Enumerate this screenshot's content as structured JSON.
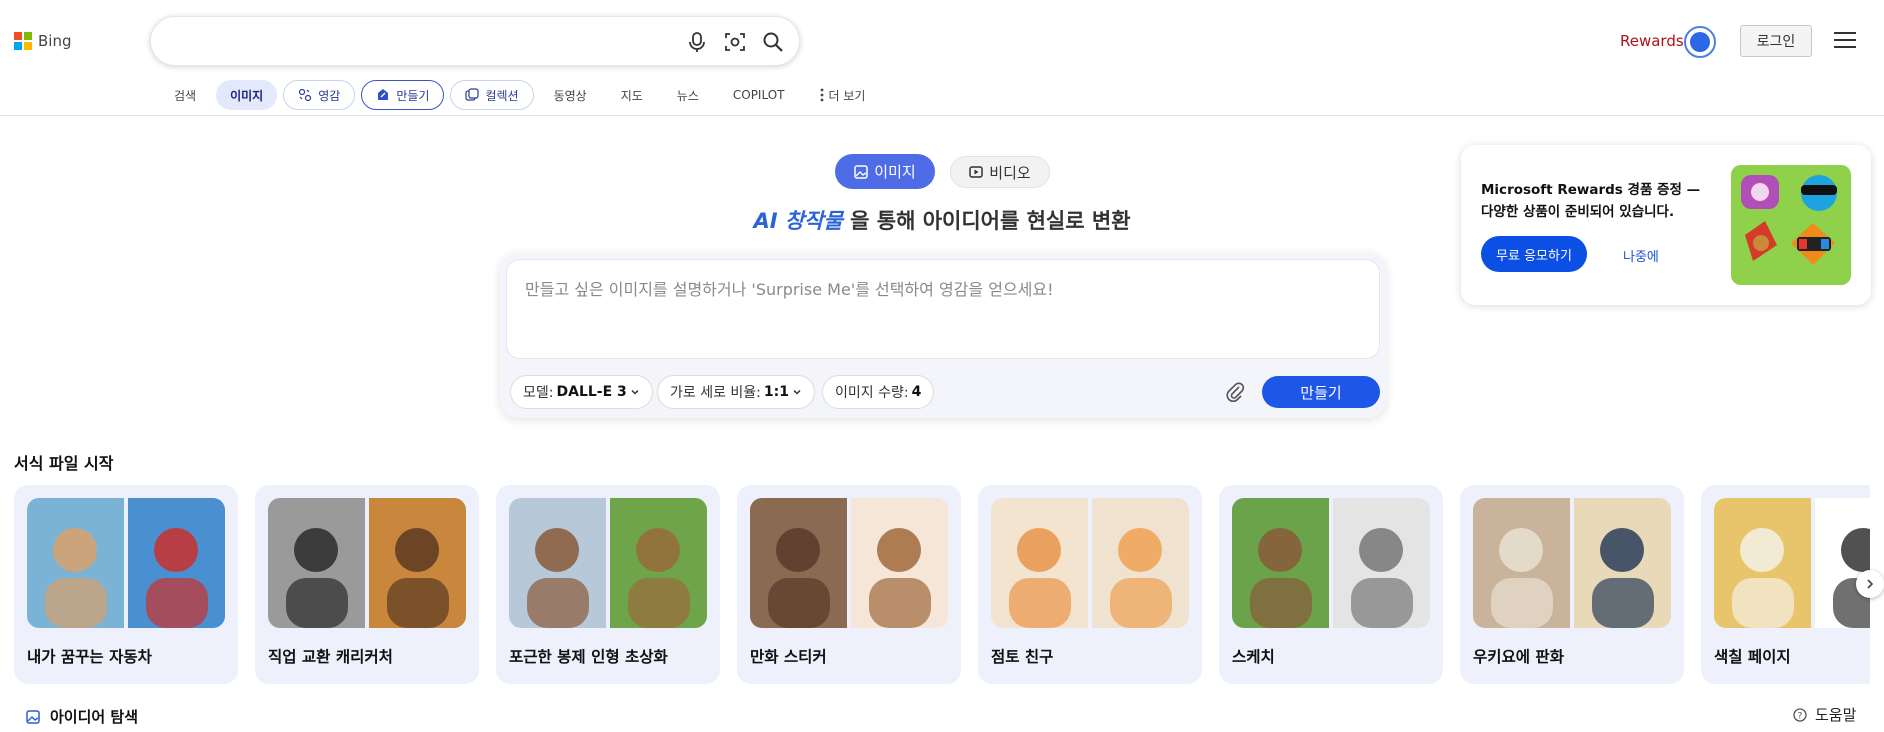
{
  "brand": {
    "name": "Bing",
    "logo_colors": [
      "#f25022",
      "#7fba00",
      "#00a4ef",
      "#ffb900"
    ]
  },
  "header": {
    "search_value": "",
    "rewards_label": "Rewards",
    "login_label": "로그인"
  },
  "nav": {
    "items": [
      {
        "label": "검색",
        "style": "plain"
      },
      {
        "label": "이미지",
        "style": "active"
      },
      {
        "label": "영감",
        "style": "pill",
        "icon": "inspiration-icon"
      },
      {
        "label": "만들기",
        "style": "pill-selected",
        "icon": "create-icon"
      },
      {
        "label": "컬렉션",
        "style": "pill",
        "icon": "collection-icon"
      },
      {
        "label": "동영상",
        "style": "plain"
      },
      {
        "label": "지도",
        "style": "plain"
      },
      {
        "label": "뉴스",
        "style": "plain"
      },
      {
        "label": "COPILOT",
        "style": "plain"
      },
      {
        "label": "더 보기",
        "style": "plain",
        "icon": "more-vertical-icon"
      }
    ]
  },
  "mode_toggle": {
    "image_label": "이미지",
    "video_label": "비디오"
  },
  "headline": {
    "highlight": "AI 창작물",
    "rest": " 을 통해 아이디어를 현실로 변환"
  },
  "prompt": {
    "placeholder": "만들고 싶은 이미지를 설명하거나 'Surprise Me'를 선택하여 영감을 얻으세요!",
    "model_label": "모델:",
    "model_value": "DALL-E 3",
    "ratio_label": "가로 세로 비율:",
    "ratio_value": "1:1",
    "count_label": "이미지 수량:",
    "count_value": "4",
    "create_label": "만들기"
  },
  "promo": {
    "text": "Microsoft Rewards 경품 증정 — 다양한 상품이 준비되어 있습니다.",
    "primary_label": "무료 응모하기",
    "secondary_label": "나중에"
  },
  "templates": {
    "title": "서식 파일 시작",
    "cards": [
      {
        "label": "내가 꿈꾸는 자동차",
        "colors": [
          "#7ab3d6",
          "#d9a16b",
          "#4a8fd0",
          "#c9302c"
        ]
      },
      {
        "label": "직업 교환 캐리커처",
        "colors": [
          "#9a9a9a",
          "#2b2b2b",
          "#c9873d",
          "#5a3a22"
        ]
      },
      {
        "label": "포근한 봉제 인형 초상화",
        "colors": [
          "#b7c9d8",
          "#8a5a3a",
          "#6fa54a",
          "#9a6a3a"
        ]
      },
      {
        "label": "만화 스티커",
        "colors": [
          "#8b6a52",
          "#5a3a2a",
          "#f5e6d8",
          "#a0683c"
        ]
      },
      {
        "label": "점토 친구",
        "colors": [
          "#f3e4d0",
          "#e9954a",
          "#efe2cf",
          "#f0a253"
        ]
      },
      {
        "label": "스케치",
        "colors": [
          "#6aa34a",
          "#8a5a3a",
          "#e4e4e4",
          "#777777"
        ]
      },
      {
        "label": "우키요에 판화",
        "colors": [
          "#c9b39a",
          "#e8e0d2",
          "#e8d9b8",
          "#2c3d5a"
        ]
      },
      {
        "label": "색칠 페이지",
        "colors": [
          "#e8c56a",
          "#f5f0e6",
          "#ffffff",
          "#333333"
        ]
      }
    ]
  },
  "footer": {
    "explore_label": "아이디어 탐색",
    "help_label": "도움말"
  }
}
